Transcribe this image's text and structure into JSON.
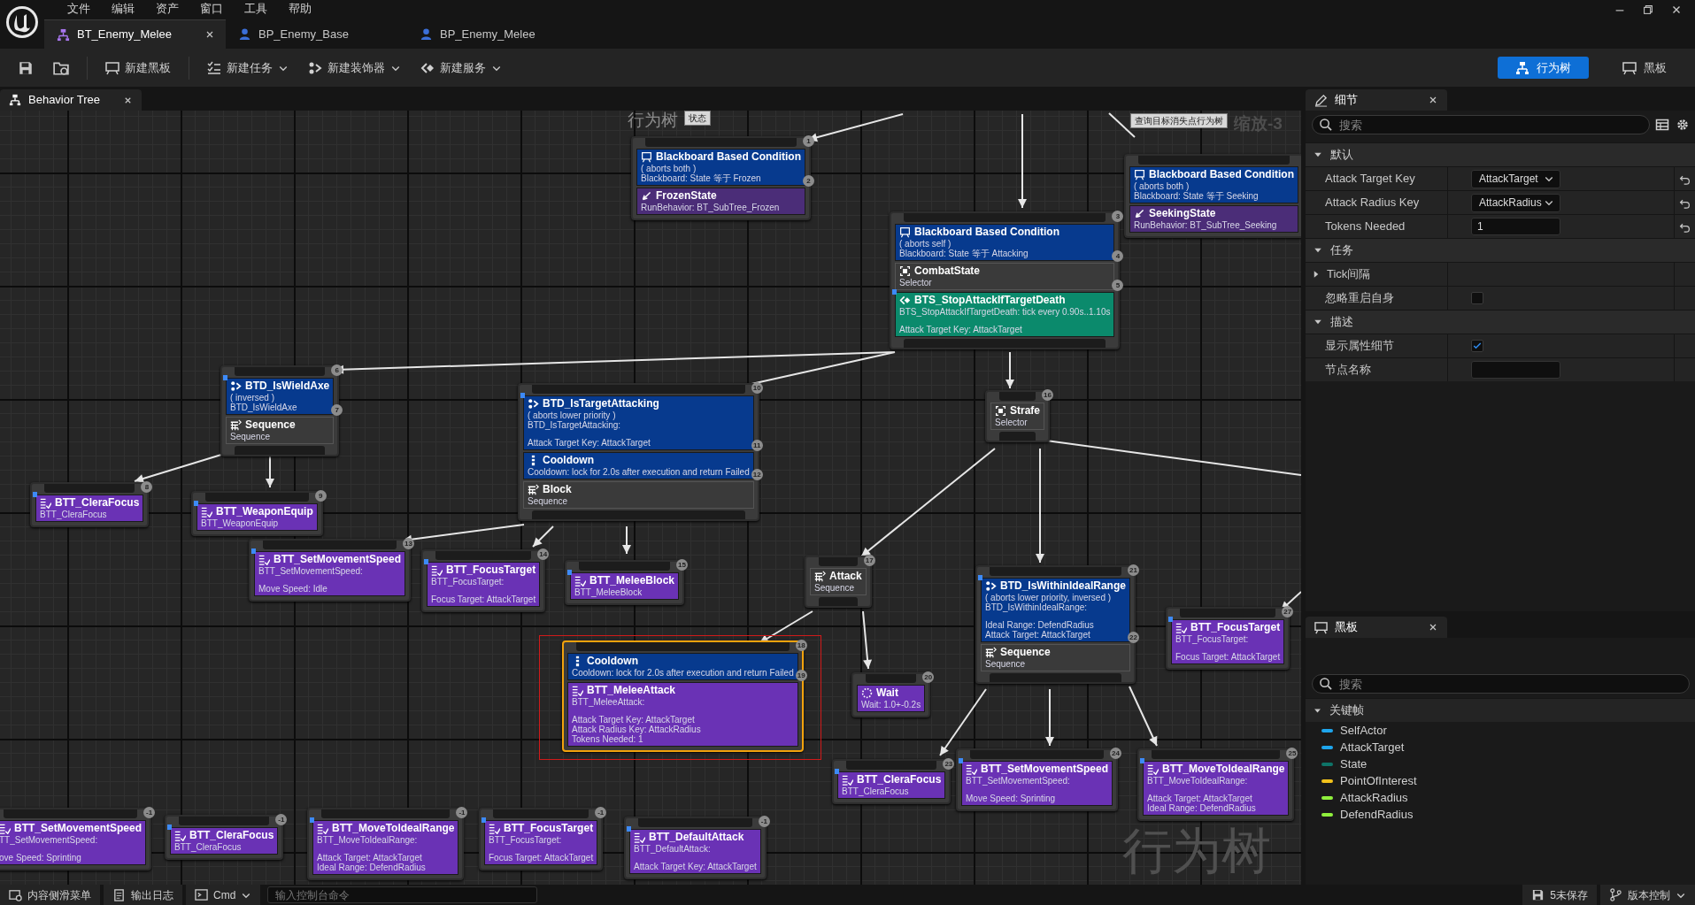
{
  "app": {
    "menu": [
      "文件",
      "编辑",
      "资产",
      "窗口",
      "工具",
      "帮助"
    ],
    "doc_tabs": [
      {
        "label": "BT_Enemy_Melee",
        "selected": true,
        "kind": "tree"
      },
      {
        "label": "BP_Enemy_Base",
        "selected": false,
        "kind": "blueprint"
      },
      {
        "label": "BP_Enemy_Melee",
        "selected": false,
        "kind": "blueprint"
      }
    ]
  },
  "toolbar": {
    "items": [
      {
        "kind": "save"
      },
      {
        "kind": "browse"
      },
      {
        "kind": "blackboard",
        "label": "新建黑板",
        "dropdown": false
      },
      {
        "kind": "task",
        "label": "新建任务",
        "dropdown": true
      },
      {
        "kind": "decorator",
        "label": "新建装饰器",
        "dropdown": true
      },
      {
        "kind": "service",
        "label": "新建服务",
        "dropdown": true
      }
    ],
    "modes": [
      {
        "kind": "tree",
        "label": "行为树",
        "selected": true
      },
      {
        "kind": "blackboard",
        "label": "黑板",
        "selected": false
      }
    ]
  },
  "graph": {
    "tab": "Behavior Tree",
    "zoom": "缩放-3",
    "watermark": "行为树",
    "comments": [
      {
        "text": "行为树",
        "tag": "状态"
      },
      {
        "tag": "查询目标消失点行为树"
      }
    ],
    "nodes": [
      {
        "index": "1",
        "selected": false,
        "sections": [
          {
            "kind": "condition",
            "blueprint": false,
            "title": "Blackboard Based Condition",
            "lines": [
              "( aborts both )",
              "Blackboard: State 等于 Frozen"
            ],
            "index": "2"
          },
          {
            "kind": "subtree",
            "blueprint": false,
            "title": "FrozenState",
            "lines": [
              "RunBehavior: BT_SubTree_Frozen"
            ]
          }
        ]
      },
      {
        "selected": false,
        "sections": [
          {
            "kind": "condition",
            "blueprint": false,
            "title": "Blackboard Based Condition",
            "lines": [
              "( aborts both )",
              "Blackboard: State 等于 Seeking"
            ]
          },
          {
            "kind": "subtree",
            "blueprint": false,
            "title": "SeekingState",
            "lines": [
              "RunBehavior: BT_SubTree_Seeking"
            ]
          }
        ]
      },
      {
        "index": "3",
        "selected": false,
        "sections": [
          {
            "kind": "condition",
            "blueprint": false,
            "title": "Blackboard Based Condition",
            "lines": [
              "( aborts self )",
              "Blackboard: State 等于 Attacking"
            ],
            "index": "4"
          },
          {
            "kind": "selector",
            "blueprint": false,
            "title": "CombatState",
            "lines": [
              "Selector"
            ],
            "index": "5"
          },
          {
            "kind": "service",
            "blueprint": true,
            "title": "BTS_StopAttackIfTargetDeath",
            "lines": [
              "BTS_StopAttackIfTargetDeath: tick every 0.90s..1.10s"
            ],
            "details": [
              "Attack Target Key: AttackTarget"
            ]
          }
        ]
      },
      {
        "index": "6",
        "selected": false,
        "sections": [
          {
            "kind": "custom_decorator",
            "blueprint": true,
            "title": "BTD_IsWieldAxe",
            "lines": [
              "( inversed )",
              "BTD_IsWieldAxe"
            ],
            "index": "7"
          },
          {
            "kind": "sequence",
            "blueprint": false,
            "title": "Sequence",
            "lines": [
              "Sequence"
            ]
          }
        ]
      },
      {
        "index": "10",
        "selected": false,
        "sections": [
          {
            "kind": "custom_decorator",
            "blueprint": true,
            "title": "BTD_IsTargetAttacking",
            "lines": [
              "( aborts lower priority )",
              "BTD_IsTargetAttacking:"
            ],
            "details": [
              "Attack Target Key: AttackTarget"
            ],
            "index": "11"
          },
          {
            "kind": "cooldown",
            "blueprint": false,
            "title": "Cooldown",
            "lines": [
              "Cooldown: lock for 2.0s after execution and return Failed"
            ],
            "index": "12"
          },
          {
            "kind": "sequence",
            "blueprint": false,
            "title": "Block",
            "lines": [
              "Sequence"
            ]
          }
        ]
      },
      {
        "index": "16",
        "selected": false,
        "sections": [
          {
            "kind": "selector",
            "blueprint": false,
            "title": "Strafe",
            "lines": [
              "Selector"
            ]
          }
        ]
      },
      {
        "index": "8",
        "selected": false,
        "sections": [
          {
            "kind": "task",
            "blueprint": true,
            "title": "BTT_CleraFocus",
            "lines": [
              "BTT_CleraFocus"
            ]
          }
        ]
      },
      {
        "index": "9",
        "selected": false,
        "sections": [
          {
            "kind": "task",
            "blueprint": true,
            "title": "BTT_WeaponEquip",
            "lines": [
              "BTT_WeaponEquip"
            ]
          }
        ]
      },
      {
        "index": "13",
        "selected": false,
        "sections": [
          {
            "kind": "task",
            "blueprint": true,
            "title": "BTT_SetMovementSpeed",
            "lines": [
              "BTT_SetMovementSpeed:"
            ],
            "details": [
              "Move Speed: Idle"
            ]
          }
        ]
      },
      {
        "index": "14",
        "selected": false,
        "sections": [
          {
            "kind": "task",
            "blueprint": true,
            "title": "BTT_FocusTarget",
            "lines": [
              "BTT_FocusTarget:"
            ],
            "details": [
              "Focus Target: AttackTarget"
            ]
          }
        ]
      },
      {
        "index": "15",
        "selected": false,
        "sections": [
          {
            "kind": "task",
            "blueprint": true,
            "title": "BTT_MeleeBlock",
            "lines": [
              "BTT_MeleeBlock"
            ]
          }
        ]
      },
      {
        "index": "17",
        "selected": false,
        "sections": [
          {
            "kind": "sequence",
            "blueprint": false,
            "title": "Attack",
            "lines": [
              "Sequence"
            ]
          }
        ]
      },
      {
        "index": "18",
        "selected": true,
        "sections": [
          {
            "kind": "cooldown",
            "blueprint": false,
            "title": "Cooldown",
            "lines": [
              "Cooldown: lock for 2.0s after execution and return Failed"
            ],
            "index": "19"
          },
          {
            "kind": "task",
            "blueprint": false,
            "title": "BTT_MeleeAttack",
            "lines": [
              "BTT_MeleeAttack:"
            ],
            "details": [
              "Attack Target Key: AttackTarget",
              "Attack Radius Key: AttackRadius",
              "Tokens Needed: 1"
            ]
          }
        ]
      },
      {
        "index": "20",
        "selected": false,
        "sections": [
          {
            "kind": "wait",
            "blueprint": false,
            "title": "Wait",
            "lines": [
              "Wait: 1.0+-0.2s"
            ]
          }
        ]
      },
      {
        "index": "21",
        "selected": false,
        "sections": [
          {
            "kind": "custom_decorator",
            "blueprint": true,
            "title": "BTD_IsWithinIdealRange",
            "lines": [
              "( aborts lower priority, inversed )",
              "BTD_IsWithinIdealRange:"
            ],
            "details": [
              "Ideal Range: DefendRadius",
              "Attack Target: AttackTarget"
            ],
            "index": "22"
          },
          {
            "kind": "sequence",
            "blueprint": false,
            "title": "Sequence",
            "lines": [
              "Sequence"
            ]
          }
        ]
      },
      {
        "index": "27",
        "selected": false,
        "sections": [
          {
            "kind": "task",
            "blueprint": true,
            "title": "BTT_FocusTarget",
            "lines": [
              "BTT_FocusTarget:"
            ],
            "details": [
              "Focus Target: AttackTarget"
            ]
          }
        ]
      },
      {
        "index": "23",
        "selected": false,
        "sections": [
          {
            "kind": "task",
            "blueprint": true,
            "title": "BTT_CleraFocus",
            "lines": [
              "BTT_CleraFocus"
            ]
          }
        ]
      },
      {
        "index": "24",
        "selected": false,
        "sections": [
          {
            "kind": "task",
            "blueprint": true,
            "title": "BTT_SetMovementSpeed",
            "lines": [
              "BTT_SetMovementSpeed:"
            ],
            "details": [
              "Move Speed: Sprinting"
            ]
          }
        ]
      },
      {
        "index": "25",
        "selected": false,
        "sections": [
          {
            "kind": "task",
            "blueprint": true,
            "title": "BTT_MoveToIdealRange",
            "lines": [
              "BTT_MoveToIdealRange:"
            ],
            "details": [
              "Attack Target: AttackTarget",
              "Ideal Range: DefendRadius"
            ]
          }
        ]
      },
      {
        "index": "-1",
        "selected": false,
        "sections": [
          {
            "kind": "task",
            "blueprint": false,
            "title": "BTT_SetMovementSpeed",
            "lines": [
              "TT_SetMovementSpeed:"
            ],
            "details": [
              "ove Speed: Sprinting"
            ]
          }
        ]
      },
      {
        "index": "-1",
        "selected": false,
        "sections": [
          {
            "kind": "task",
            "blueprint": true,
            "title": "BTT_CleraFocus",
            "lines": [
              "BTT_CleraFocus"
            ]
          }
        ]
      },
      {
        "index": "-1",
        "selected": false,
        "sections": [
          {
            "kind": "task",
            "blueprint": true,
            "title": "BTT_MoveToIdealRange",
            "lines": [
              "BTT_MoveToIdealRange:"
            ],
            "details": [
              "Attack Target: AttackTarget",
              "Ideal Range: DefendRadius"
            ]
          }
        ]
      },
      {
        "index": "-1",
        "selected": false,
        "sections": [
          {
            "kind": "task",
            "blueprint": true,
            "title": "BTT_FocusTarget",
            "lines": [
              "BTT_FocusTarget:"
            ],
            "details": [
              "Focus Target: AttackTarget"
            ]
          }
        ]
      },
      {
        "index": "-1",
        "selected": false,
        "sections": [
          {
            "kind": "task",
            "blueprint": true,
            "title": "BTT_DefaultAttack",
            "lines": [
              "BTT_DefaultAttack:"
            ],
            "details": [
              "Attack Target Key: AttackTarget"
            ]
          }
        ]
      }
    ]
  },
  "details": {
    "tab": "细节",
    "search_placeholder": "搜索",
    "categories": [
      {
        "title": "默认",
        "expanded": true,
        "rows": [
          {
            "label": "Attack Target Key",
            "kind": "dropdown",
            "value": "AttackTarget",
            "resettable": true
          },
          {
            "label": "Attack Radius Key",
            "kind": "dropdown",
            "value": "AttackRadius",
            "resettable": true
          },
          {
            "label": "Tokens Needed",
            "kind": "text",
            "value": "1",
            "resettable": true
          }
        ]
      },
      {
        "title": "任务",
        "expanded": true,
        "rows": [
          {
            "label": "Tick间隔",
            "kind": "group",
            "expanded": false,
            "resettable": false
          },
          {
            "label": "忽略重启自身",
            "kind": "checkbox",
            "checked": false,
            "resettable": false
          }
        ]
      },
      {
        "title": "描述",
        "expanded": true,
        "rows": [
          {
            "label": "显示属性细节",
            "kind": "checkbox",
            "checked": true,
            "resettable": false
          },
          {
            "label": "节点名称",
            "kind": "text",
            "resettable": false
          }
        ]
      }
    ]
  },
  "blackboard": {
    "tab": "黑板",
    "search_placeholder": "搜索",
    "category": {
      "title": "关键帧",
      "expanded": true
    },
    "keys": [
      {
        "name": "SelfActor",
        "color": "#1ea5ec"
      },
      {
        "name": "AttackTarget",
        "color": "#1ea5ec"
      },
      {
        "name": "State",
        "color": "#0e7468"
      },
      {
        "name": "PointOfInterest",
        "color": "#f2c21b"
      },
      {
        "name": "AttackRadius",
        "color": "#8ff03c"
      },
      {
        "name": "DefendRadius",
        "color": "#8ff03c"
      }
    ]
  },
  "status_bar": {
    "items": [
      {
        "kind": "drawer",
        "label": "内容侧滑菜单"
      },
      {
        "kind": "log",
        "label": "输出日志"
      },
      {
        "kind": "cmd",
        "label": "Cmd"
      }
    ],
    "console_placeholder": "输入控制台命令",
    "right": [
      {
        "kind": "save",
        "label": "5未保存"
      },
      {
        "kind": "source",
        "label": "版本控制"
      }
    ]
  }
}
